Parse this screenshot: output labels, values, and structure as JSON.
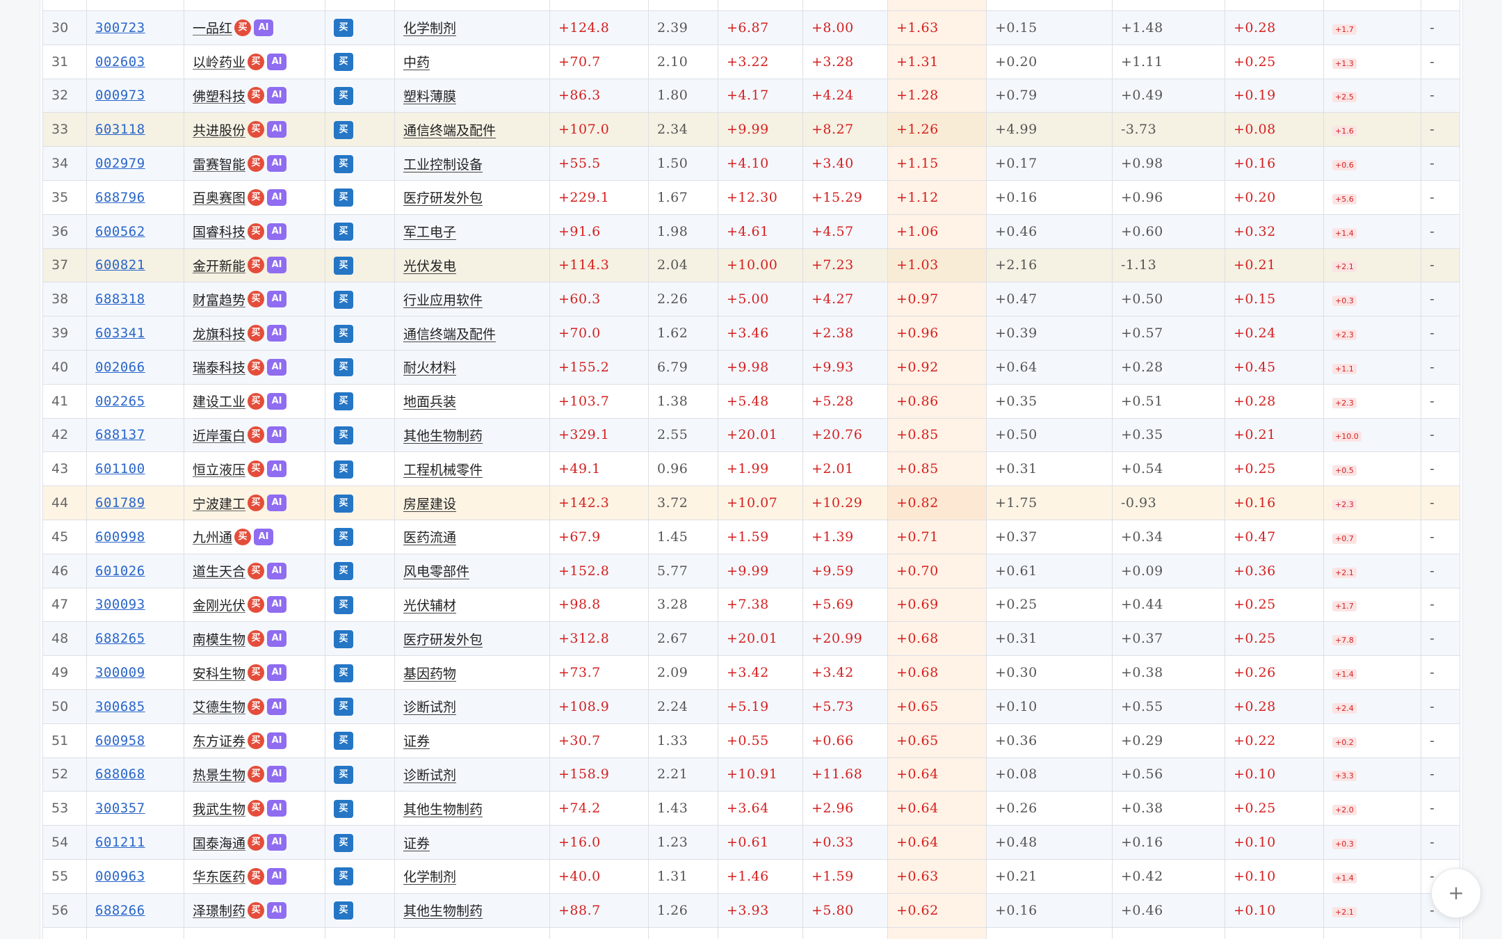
{
  "accent": {
    "up": "#d51f1f",
    "link": "#2a66c9",
    "buy_badge": "#e44d3a",
    "ai_badge": "#8f6cf0",
    "action_badge": "#2576c5"
  },
  "badges": {
    "buy": "买",
    "ai": "AI",
    "action": "买"
  },
  "fab": {
    "icon": "plus-icon",
    "label": "+"
  },
  "rows": [
    {
      "idx": "30",
      "code": "300723",
      "name": "一品红",
      "industry": "化学制剂",
      "v1": "+124.8",
      "v2": "2.39",
      "v3": "+6.87",
      "v4": "+8.00",
      "v5": "+1.63",
      "v6": "+0.15",
      "v7": "+1.48",
      "v8": "+0.28",
      "tag": "+1.7",
      "last": "-",
      "style": "even"
    },
    {
      "idx": "31",
      "code": "002603",
      "name": "以岭药业",
      "industry": "中药",
      "v1": "+70.7",
      "v2": "2.10",
      "v3": "+3.22",
      "v4": "+3.28",
      "v5": "+1.31",
      "v6": "+0.20",
      "v7": "+1.11",
      "v8": "+0.25",
      "tag": "+1.3",
      "last": "-",
      "style": "odd"
    },
    {
      "idx": "32",
      "code": "000973",
      "name": "佛塑科技",
      "industry": "塑料薄膜",
      "v1": "+86.3",
      "v2": "1.80",
      "v3": "+4.17",
      "v4": "+4.24",
      "v5": "+1.28",
      "v6": "+0.79",
      "v7": "+0.49",
      "v8": "+0.19",
      "tag": "+2.5",
      "last": "-",
      "style": "even"
    },
    {
      "idx": "33",
      "code": "603118",
      "name": "共进股份",
      "industry": "通信终端及配件",
      "v1": "+107.0",
      "v2": "2.34",
      "v3": "+9.99",
      "v4": "+8.27",
      "v5": "+1.26",
      "v6": "+4.99",
      "v7": "-3.73",
      "v8": "+0.08",
      "tag": "+1.6",
      "last": "-",
      "style": "tan"
    },
    {
      "idx": "34",
      "code": "002979",
      "name": "雷赛智能",
      "industry": "工业控制设备",
      "v1": "+55.5",
      "v2": "1.50",
      "v3": "+4.10",
      "v4": "+3.40",
      "v5": "+1.15",
      "v6": "+0.17",
      "v7": "+0.98",
      "v8": "+0.16",
      "tag": "+0.6",
      "last": "-",
      "style": "even"
    },
    {
      "idx": "35",
      "code": "688796",
      "name": "百奥赛图",
      "industry": "医疗研发外包",
      "v1": "+229.1",
      "v2": "1.67",
      "v3": "+12.30",
      "v4": "+15.29",
      "v5": "+1.12",
      "v6": "+0.16",
      "v7": "+0.96",
      "v8": "+0.20",
      "tag": "+5.6",
      "last": "-",
      "style": "odd"
    },
    {
      "idx": "36",
      "code": "600562",
      "name": "国睿科技",
      "industry": "军工电子",
      "v1": "+91.6",
      "v2": "1.98",
      "v3": "+4.61",
      "v4": "+4.57",
      "v5": "+1.06",
      "v6": "+0.46",
      "v7": "+0.60",
      "v8": "+0.32",
      "tag": "+1.4",
      "last": "-",
      "style": "even"
    },
    {
      "idx": "37",
      "code": "600821",
      "name": "金开新能",
      "industry": "光伏发电",
      "v1": "+114.3",
      "v2": "2.04",
      "v3": "+10.00",
      "v4": "+7.23",
      "v5": "+1.03",
      "v6": "+2.16",
      "v7": "-1.13",
      "v8": "+0.21",
      "tag": "+2.1",
      "last": "-",
      "style": "tan"
    },
    {
      "idx": "38",
      "code": "688318",
      "name": "财富趋势",
      "industry": "行业应用软件",
      "v1": "+60.3",
      "v2": "2.26",
      "v3": "+5.00",
      "v4": "+4.27",
      "v5": "+0.97",
      "v6": "+0.47",
      "v7": "+0.50",
      "v8": "+0.15",
      "tag": "+0.3",
      "last": "-",
      "style": "even"
    },
    {
      "idx": "39",
      "code": "603341",
      "name": "龙旗科技",
      "industry": "通信终端及配件",
      "v1": "+70.0",
      "v2": "1.62",
      "v3": "+3.46",
      "v4": "+2.38",
      "v5": "+0.96",
      "v6": "+0.39",
      "v7": "+0.57",
      "v8": "+0.24",
      "tag": "+2.3",
      "last": "-",
      "style": "even"
    },
    {
      "idx": "40",
      "code": "002066",
      "name": "瑞泰科技",
      "industry": "耐火材料",
      "v1": "+155.2",
      "v2": "6.79",
      "v3": "+9.98",
      "v4": "+9.93",
      "v5": "+0.92",
      "v6": "+0.64",
      "v7": "+0.28",
      "v8": "+0.45",
      "tag": "+1.1",
      "last": "-",
      "style": "even"
    },
    {
      "idx": "41",
      "code": "002265",
      "name": "建设工业",
      "industry": "地面兵装",
      "v1": "+103.7",
      "v2": "1.38",
      "v3": "+5.48",
      "v4": "+5.28",
      "v5": "+0.86",
      "v6": "+0.35",
      "v7": "+0.51",
      "v8": "+0.28",
      "tag": "+2.3",
      "last": "-",
      "style": "odd"
    },
    {
      "idx": "42",
      "code": "688137",
      "name": "近岸蛋白",
      "industry": "其他生物制药",
      "v1": "+329.1",
      "v2": "2.55",
      "v3": "+20.01",
      "v4": "+20.76",
      "v5": "+0.85",
      "v6": "+0.50",
      "v7": "+0.35",
      "v8": "+0.21",
      "tag": "+10.0",
      "last": "-",
      "style": "even"
    },
    {
      "idx": "43",
      "code": "601100",
      "name": "恒立液压",
      "industry": "工程机械零件",
      "v1": "+49.1",
      "v2": "0.96",
      "v3": "+1.99",
      "v4": "+2.01",
      "v5": "+0.85",
      "v6": "+0.31",
      "v7": "+0.54",
      "v8": "+0.25",
      "tag": "+0.5",
      "last": "-",
      "style": "odd"
    },
    {
      "idx": "44",
      "code": "601789",
      "name": "宁波建工",
      "industry": "房屋建设",
      "v1": "+142.3",
      "v2": "3.72",
      "v3": "+10.07",
      "v4": "+10.29",
      "v5": "+0.82",
      "v6": "+1.75",
      "v7": "-0.93",
      "v8": "+0.16",
      "tag": "+2.3",
      "last": "-",
      "style": "peach"
    },
    {
      "idx": "45",
      "code": "600998",
      "name": "九州通",
      "industry": "医药流通",
      "v1": "+67.9",
      "v2": "1.45",
      "v3": "+1.59",
      "v4": "+1.39",
      "v5": "+0.71",
      "v6": "+0.37",
      "v7": "+0.34",
      "v8": "+0.47",
      "tag": "+0.7",
      "last": "-",
      "style": "odd"
    },
    {
      "idx": "46",
      "code": "601026",
      "name": "道生天合",
      "industry": "风电零部件",
      "v1": "+152.8",
      "v2": "5.77",
      "v3": "+9.99",
      "v4": "+9.59",
      "v5": "+0.70",
      "v6": "+0.61",
      "v7": "+0.09",
      "v8": "+0.36",
      "tag": "+2.1",
      "last": "-",
      "style": "even"
    },
    {
      "idx": "47",
      "code": "300093",
      "name": "金刚光伏",
      "industry": "光伏辅材",
      "v1": "+98.8",
      "v2": "3.28",
      "v3": "+7.38",
      "v4": "+5.69",
      "v5": "+0.69",
      "v6": "+0.25",
      "v7": "+0.44",
      "v8": "+0.25",
      "tag": "+1.7",
      "last": "-",
      "style": "odd"
    },
    {
      "idx": "48",
      "code": "688265",
      "name": "南模生物",
      "industry": "医疗研发外包",
      "v1": "+312.8",
      "v2": "2.67",
      "v3": "+20.01",
      "v4": "+20.99",
      "v5": "+0.68",
      "v6": "+0.31",
      "v7": "+0.37",
      "v8": "+0.25",
      "tag": "+7.8",
      "last": "-",
      "style": "even"
    },
    {
      "idx": "49",
      "code": "300009",
      "name": "安科生物",
      "industry": "基因药物",
      "v1": "+73.7",
      "v2": "2.09",
      "v3": "+3.42",
      "v4": "+3.42",
      "v5": "+0.68",
      "v6": "+0.30",
      "v7": "+0.38",
      "v8": "+0.26",
      "tag": "+1.4",
      "last": "-",
      "style": "odd"
    },
    {
      "idx": "50",
      "code": "300685",
      "name": "艾德生物",
      "industry": "诊断试剂",
      "v1": "+108.9",
      "v2": "2.24",
      "v3": "+5.19",
      "v4": "+5.73",
      "v5": "+0.65",
      "v6": "+0.10",
      "v7": "+0.55",
      "v8": "+0.28",
      "tag": "+2.4",
      "last": "-",
      "style": "even"
    },
    {
      "idx": "51",
      "code": "600958",
      "name": "东方证券",
      "industry": "证券",
      "v1": "+30.7",
      "v2": "1.33",
      "v3": "+0.55",
      "v4": "+0.66",
      "v5": "+0.65",
      "v6": "+0.36",
      "v7": "+0.29",
      "v8": "+0.22",
      "tag": "+0.2",
      "last": "-",
      "style": "odd"
    },
    {
      "idx": "52",
      "code": "688068",
      "name": "热景生物",
      "industry": "诊断试剂",
      "v1": "+158.9",
      "v2": "2.21",
      "v3": "+10.91",
      "v4": "+11.68",
      "v5": "+0.64",
      "v6": "+0.08",
      "v7": "+0.56",
      "v8": "+0.10",
      "tag": "+3.3",
      "last": "-",
      "style": "even"
    },
    {
      "idx": "53",
      "code": "300357",
      "name": "我武生物",
      "industry": "其他生物制药",
      "v1": "+74.2",
      "v2": "1.43",
      "v3": "+3.64",
      "v4": "+2.96",
      "v5": "+0.64",
      "v6": "+0.26",
      "v7": "+0.38",
      "v8": "+0.25",
      "tag": "+2.0",
      "last": "-",
      "style": "odd"
    },
    {
      "idx": "54",
      "code": "601211",
      "name": "国泰海通",
      "industry": "证券",
      "v1": "+16.0",
      "v2": "1.23",
      "v3": "+0.61",
      "v4": "+0.33",
      "v5": "+0.64",
      "v6": "+0.48",
      "v7": "+0.16",
      "v8": "+0.10",
      "tag": "+0.3",
      "last": "-",
      "style": "even"
    },
    {
      "idx": "55",
      "code": "000963",
      "name": "华东医药",
      "industry": "化学制剂",
      "v1": "+40.0",
      "v2": "1.31",
      "v3": "+1.46",
      "v4": "+1.59",
      "v5": "+0.63",
      "v6": "+0.21",
      "v7": "+0.42",
      "v8": "+0.10",
      "tag": "+1.4",
      "last": "-",
      "style": "odd"
    },
    {
      "idx": "56",
      "code": "688266",
      "name": "泽璟制药",
      "industry": "其他生物制药",
      "v1": "+88.7",
      "v2": "1.26",
      "v3": "+3.93",
      "v4": "+5.80",
      "v5": "+0.62",
      "v6": "+0.16",
      "v7": "+0.46",
      "v8": "+0.10",
      "tag": "+2.1",
      "last": "-",
      "style": "even"
    }
  ]
}
